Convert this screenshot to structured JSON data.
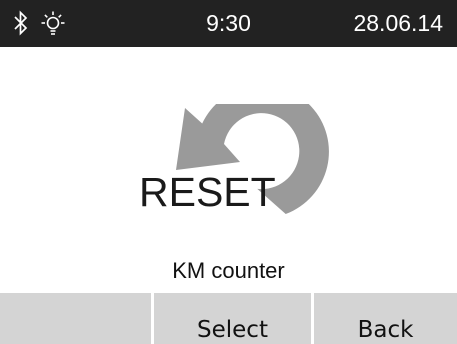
{
  "status_bar": {
    "time": "9:30",
    "date": "28.06.14",
    "icons": [
      "bluetooth-icon",
      "brightness-icon"
    ]
  },
  "main": {
    "reset_label": "RESET",
    "function_name": "KM counter",
    "icon": "reset-arrow-icon"
  },
  "softkeys": {
    "left_label": "",
    "middle_label": "Select",
    "right_label": "Back"
  },
  "colors": {
    "status_bar_bg": "#222222",
    "softkey_bg": "#d4d4d4",
    "arrow_fill": "#9a9a9a"
  }
}
